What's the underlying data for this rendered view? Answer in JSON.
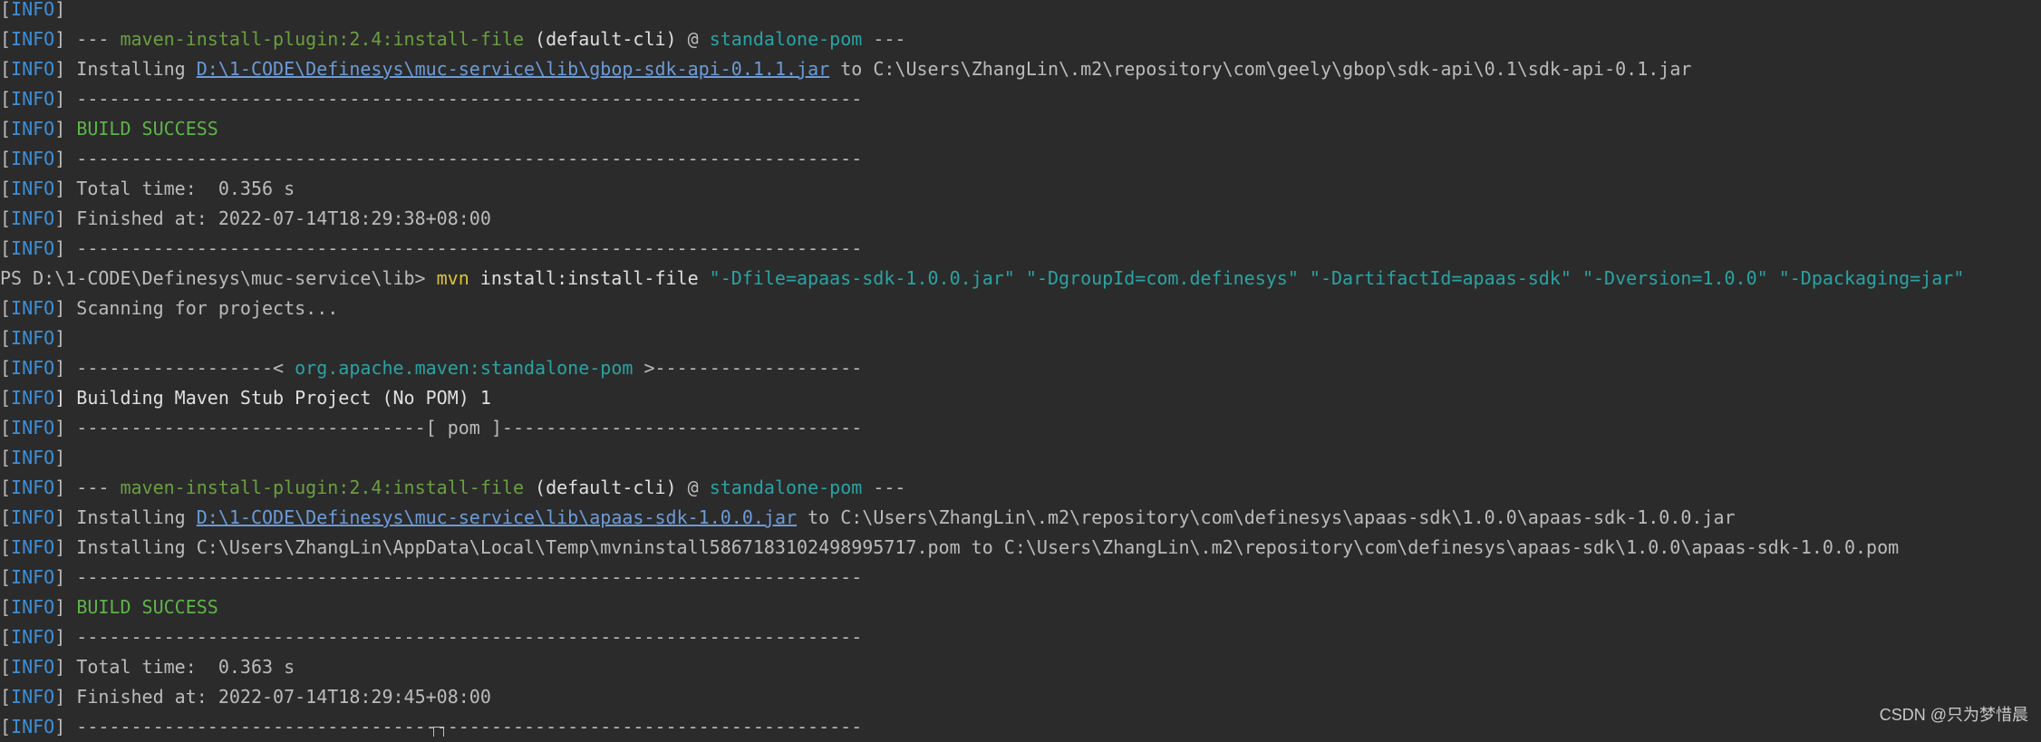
{
  "colors": {
    "background": "#2b2b2b",
    "info_tag": "#3f8fd6",
    "plugin": "#6a9f40",
    "cyan": "#2aa3a3",
    "command": "#e0c33a",
    "success": "#5fb34a",
    "link": "#6c9bd6"
  },
  "terminal": {
    "lines": [
      [
        {
          "t": "[",
          "c": "br"
        },
        {
          "t": "INFO",
          "c": "info"
        },
        {
          "t": "]",
          "c": "br"
        }
      ],
      [
        {
          "t": "[",
          "c": "br"
        },
        {
          "t": "INFO",
          "c": "info"
        },
        {
          "t": "] --- ",
          "c": "s"
        },
        {
          "t": "maven-install-plugin:2.4:install-file",
          "c": "g"
        },
        {
          "t": " (default-cli)",
          "c": "w"
        },
        {
          "t": " @ ",
          "c": "s"
        },
        {
          "t": "standalone-pom",
          "c": "c"
        },
        {
          "t": " ---",
          "c": "s"
        }
      ],
      [
        {
          "t": "[",
          "c": "br"
        },
        {
          "t": "INFO",
          "c": "info"
        },
        {
          "t": "] Installing ",
          "c": "s"
        },
        {
          "t": "D:\\1-CODE\\Definesys\\muc-service\\lib\\gbop-sdk-api-0.1.1.jar",
          "c": "lnk",
          "link": true
        },
        {
          "t": " to C:\\Users\\ZhangLin\\.m2\\repository\\com\\geely\\gbop\\sdk-api\\0.1\\sdk-api-0.1.jar",
          "c": "s"
        }
      ],
      [
        {
          "t": "[",
          "c": "br"
        },
        {
          "t": "INFO",
          "c": "info"
        },
        {
          "t": "] ------------------------------------------------------------------------",
          "c": "s"
        }
      ],
      [
        {
          "t": "[",
          "c": "br"
        },
        {
          "t": "INFO",
          "c": "info"
        },
        {
          "t": "] ",
          "c": "s"
        },
        {
          "t": "BUILD SUCCESS",
          "c": "ok"
        }
      ],
      [
        {
          "t": "[",
          "c": "br"
        },
        {
          "t": "INFO",
          "c": "info"
        },
        {
          "t": "] ------------------------------------------------------------------------",
          "c": "s"
        }
      ],
      [
        {
          "t": "[",
          "c": "br"
        },
        {
          "t": "INFO",
          "c": "info"
        },
        {
          "t": "] Total time:  0.356 s",
          "c": "s"
        }
      ],
      [
        {
          "t": "[",
          "c": "br"
        },
        {
          "t": "INFO",
          "c": "info"
        },
        {
          "t": "] Finished at: 2022-07-14T18:29:38+08:00",
          "c": "s"
        }
      ],
      [
        {
          "t": "[",
          "c": "br"
        },
        {
          "t": "INFO",
          "c": "info"
        },
        {
          "t": "] ------------------------------------------------------------------------",
          "c": "s"
        }
      ],
      [
        {
          "t": "PS D:\\1-CODE\\Definesys\\muc-service\\lib> ",
          "c": "s"
        },
        {
          "t": "mvn",
          "c": "y"
        },
        {
          "t": " install:install-file ",
          "c": "w"
        },
        {
          "t": "\"-Dfile=apaas-sdk-1.0.0.jar\" \"-DgroupId=com.definesys\" \"-DartifactId=apaas-sdk\" \"-Dversion=1.0.0\" \"-Dpackaging=jar\"",
          "c": "c"
        }
      ],
      [
        {
          "t": "[",
          "c": "br"
        },
        {
          "t": "INFO",
          "c": "info"
        },
        {
          "t": "] Scanning for projects...",
          "c": "s"
        }
      ],
      [
        {
          "t": "[",
          "c": "br"
        },
        {
          "t": "INFO",
          "c": "info"
        },
        {
          "t": "]",
          "c": "br"
        }
      ],
      [
        {
          "t": "[",
          "c": "br"
        },
        {
          "t": "INFO",
          "c": "info"
        },
        {
          "t": "] ------------------< ",
          "c": "s"
        },
        {
          "t": "org.apache.maven:standalone-pom",
          "c": "c"
        },
        {
          "t": " >-------------------",
          "c": "s"
        }
      ],
      [
        {
          "t": "[",
          "c": "br"
        },
        {
          "t": "INFO",
          "c": "info"
        },
        {
          "t": "] Building Maven Stub Project (No POM) 1",
          "c": "w"
        }
      ],
      [
        {
          "t": "[",
          "c": "br"
        },
        {
          "t": "INFO",
          "c": "info"
        },
        {
          "t": "] --------------------------------[ pom ]---------------------------------",
          "c": "s"
        }
      ],
      [
        {
          "t": "[",
          "c": "br"
        },
        {
          "t": "INFO",
          "c": "info"
        },
        {
          "t": "]",
          "c": "br"
        }
      ],
      [
        {
          "t": "[",
          "c": "br"
        },
        {
          "t": "INFO",
          "c": "info"
        },
        {
          "t": "] --- ",
          "c": "s"
        },
        {
          "t": "maven-install-plugin:2.4:install-file",
          "c": "g"
        },
        {
          "t": " (default-cli)",
          "c": "w"
        },
        {
          "t": " @ ",
          "c": "s"
        },
        {
          "t": "standalone-pom",
          "c": "c"
        },
        {
          "t": " ---",
          "c": "s"
        }
      ],
      [
        {
          "t": "[",
          "c": "br"
        },
        {
          "t": "INFO",
          "c": "info"
        },
        {
          "t": "] Installing ",
          "c": "s"
        },
        {
          "t": "D:\\1-CODE\\Definesys\\muc-service\\lib\\apaas-sdk-1.0.0.jar",
          "c": "lnk",
          "link": true
        },
        {
          "t": " to C:\\Users\\ZhangLin\\.m2\\repository\\com\\definesys\\apaas-sdk\\1.0.0\\apaas-sdk-1.0.0.jar",
          "c": "s"
        }
      ],
      [
        {
          "t": "[",
          "c": "br"
        },
        {
          "t": "INFO",
          "c": "info"
        },
        {
          "t": "] Installing C:\\Users\\ZhangLin\\AppData\\Local\\Temp\\mvninstall5867183102498995717.pom to C:\\Users\\ZhangLin\\.m2\\repository\\com\\definesys\\apaas-sdk\\1.0.0\\apaas-sdk-1.0.0.pom",
          "c": "s"
        }
      ],
      [
        {
          "t": "[",
          "c": "br"
        },
        {
          "t": "INFO",
          "c": "info"
        },
        {
          "t": "] ------------------------------------------------------------------------",
          "c": "s"
        }
      ],
      [
        {
          "t": "[",
          "c": "br"
        },
        {
          "t": "INFO",
          "c": "info"
        },
        {
          "t": "] ",
          "c": "s"
        },
        {
          "t": "BUILD SUCCESS",
          "c": "ok"
        }
      ],
      [
        {
          "t": "[",
          "c": "br"
        },
        {
          "t": "INFO",
          "c": "info"
        },
        {
          "t": "] ------------------------------------------------------------------------",
          "c": "s"
        }
      ],
      [
        {
          "t": "[",
          "c": "br"
        },
        {
          "t": "INFO",
          "c": "info"
        },
        {
          "t": "] Total time:  0.363 s",
          "c": "s"
        }
      ],
      [
        {
          "t": "[",
          "c": "br"
        },
        {
          "t": "INFO",
          "c": "info"
        },
        {
          "t": "] Finished at: 2022-07-14T18:29:45+08:00",
          "c": "s"
        }
      ],
      [
        {
          "t": "[",
          "c": "br"
        },
        {
          "t": "INFO",
          "c": "info"
        },
        {
          "t": "] ------------------------------------------------------------------------",
          "c": "s"
        }
      ]
    ]
  },
  "watermark": "CSDN @只为梦惜晨"
}
